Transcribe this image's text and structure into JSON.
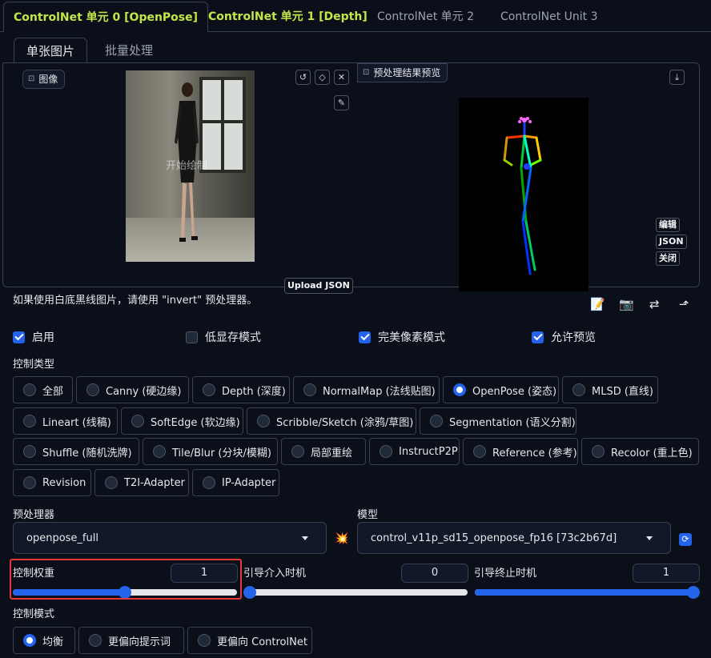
{
  "unit_tabs": [
    {
      "label": "ControlNet 单元 0 [OpenPose]"
    },
    {
      "label": "ControlNet 单元 1 [Depth]"
    },
    {
      "label": "ControlNet 单元 2"
    },
    {
      "label": "ControlNet Unit 3"
    }
  ],
  "image_tabs": [
    {
      "label": "单张图片"
    },
    {
      "label": "批量处理"
    }
  ],
  "image_panel": {
    "input_label": "图像",
    "start_draw": "开始绘制",
    "upload_json": "Upload JSON",
    "preview_label": "预处理结果预览",
    "edit_label": "编辑",
    "json_label": "JSON",
    "close_label": "关闭"
  },
  "hint": "如果使用白底黑线图片，请使用 \"invert\" 预处理器。",
  "checkboxes": [
    {
      "label": "启用",
      "checked": true
    },
    {
      "label": "低显存模式",
      "checked": false
    },
    {
      "label": "完美像素模式",
      "checked": true
    },
    {
      "label": "允许预览",
      "checked": true
    }
  ],
  "control_type": {
    "label": "控制类型",
    "options": [
      {
        "label": "全部",
        "selected": false
      },
      {
        "label": "Canny (硬边缘)",
        "selected": false
      },
      {
        "label": "Depth (深度)",
        "selected": false
      },
      {
        "label": "NormalMap (法线贴图)",
        "selected": false
      },
      {
        "label": "OpenPose (姿态)",
        "selected": true
      },
      {
        "label": "MLSD (直线)",
        "selected": false
      },
      {
        "label": "Lineart (线稿)",
        "selected": false
      },
      {
        "label": "SoftEdge (软边缘)",
        "selected": false
      },
      {
        "label": "Scribble/Sketch (涂鸦/草图)",
        "selected": false
      },
      {
        "label": "Segmentation (语义分割)",
        "selected": false
      },
      {
        "label": "Shuffle (随机洗牌)",
        "selected": false
      },
      {
        "label": "Tile/Blur (分块/模糊)",
        "selected": false
      },
      {
        "label": "局部重绘",
        "selected": false
      },
      {
        "label": "InstructP2P",
        "selected": false
      },
      {
        "label": "Reference (参考)",
        "selected": false
      },
      {
        "label": "Recolor (重上色)",
        "selected": false
      },
      {
        "label": "Revision",
        "selected": false
      },
      {
        "label": "T2I-Adapter",
        "selected": false
      },
      {
        "label": "IP-Adapter",
        "selected": false
      }
    ]
  },
  "preprocessor": {
    "label": "预处理器",
    "value": "openpose_full"
  },
  "model": {
    "label": "模型",
    "value": "control_v11p_sd15_openpose_fp16 [73c2b67d]"
  },
  "sliders": [
    {
      "label": "控制权重",
      "value": "1",
      "fraction": 0.5
    },
    {
      "label": "引导介入时机",
      "value": "0",
      "fraction": 0.0
    },
    {
      "label": "引导终止时机",
      "value": "1",
      "fraction": 1.0
    }
  ],
  "control_mode": {
    "label": "控制模式",
    "options": [
      {
        "label": "均衡",
        "selected": true
      },
      {
        "label": "更偏向提示词",
        "selected": false
      },
      {
        "label": "更偏向 ControlNet",
        "selected": false
      }
    ]
  },
  "colors": {
    "accent": "#2563eb",
    "tab_active": "#c3e74a",
    "highlight": "#e53935"
  }
}
